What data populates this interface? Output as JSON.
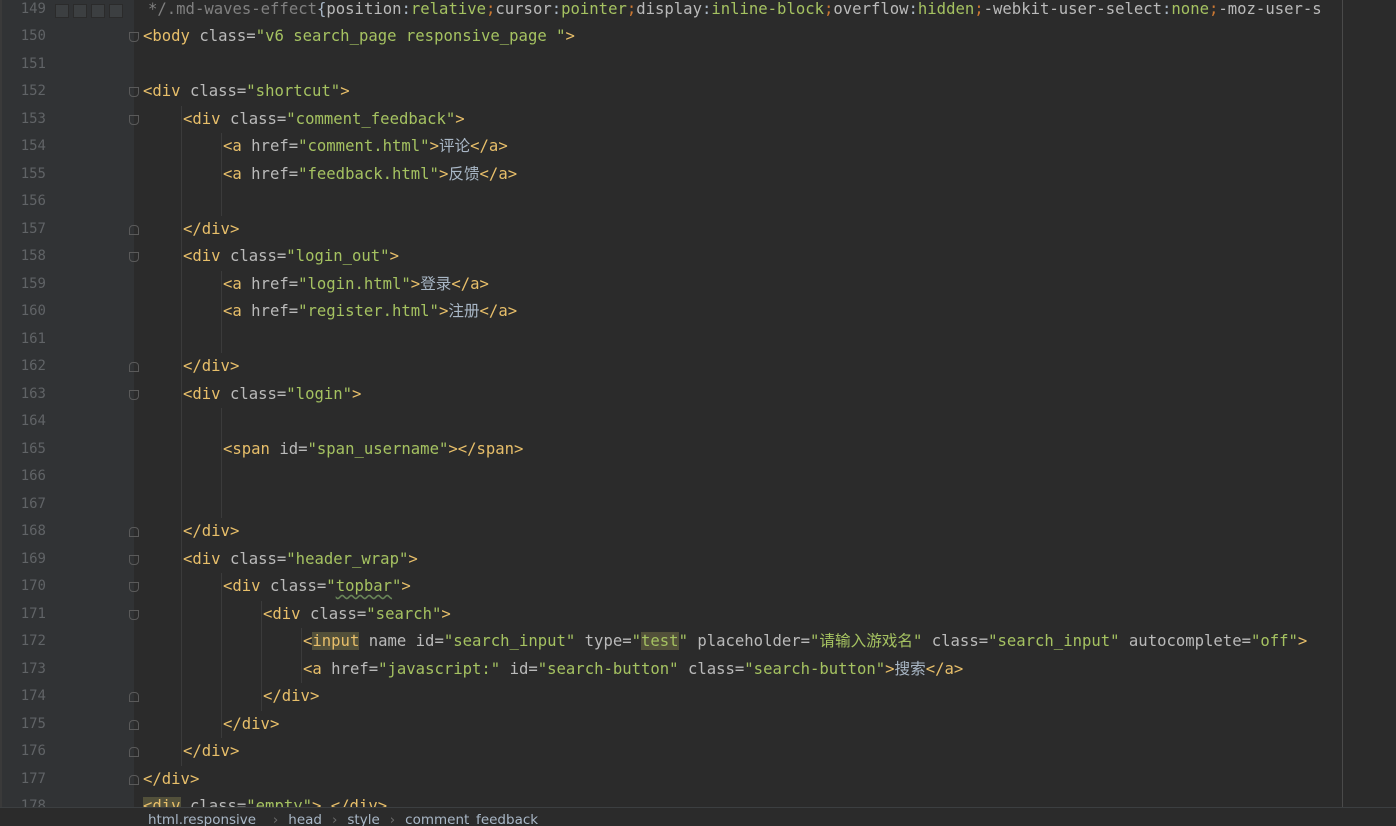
{
  "editor": {
    "lines": [
      {
        "n": "149",
        "fold": "none",
        "indent": 0,
        "tokens": [
          [
            "comment",
            " */.md-waves-effect"
          ],
          [
            "text",
            "{"
          ],
          [
            "cssprop",
            "position"
          ],
          [
            "text",
            ":"
          ],
          [
            "cssval",
            "relative"
          ],
          [
            "punct",
            ";"
          ],
          [
            "cssprop",
            "cursor"
          ],
          [
            "text",
            ":"
          ],
          [
            "cssval",
            "pointer"
          ],
          [
            "punct",
            ";"
          ],
          [
            "cssprop",
            "display"
          ],
          [
            "text",
            ":"
          ],
          [
            "cssval",
            "inline-block"
          ],
          [
            "punct",
            ";"
          ],
          [
            "cssprop",
            "overflow"
          ],
          [
            "text",
            ":"
          ],
          [
            "cssval",
            "hidden"
          ],
          [
            "punct",
            ";"
          ],
          [
            "cssprop",
            "-webkit-user-select"
          ],
          [
            "text",
            ":"
          ],
          [
            "cssval",
            "none"
          ],
          [
            "punct",
            ";"
          ],
          [
            "cssprop",
            "-moz-user-s"
          ]
        ]
      },
      {
        "n": "150",
        "fold": "open",
        "indent": 0,
        "tokens": [
          [
            "tag",
            "<body "
          ],
          [
            "attr",
            "class="
          ],
          [
            "str",
            "\"v6 search_page responsive_page \""
          ],
          [
            "tag",
            ">"
          ]
        ]
      },
      {
        "n": "151",
        "fold": "none",
        "indent": 0,
        "tokens": []
      },
      {
        "n": "152",
        "fold": "open",
        "indent": 0,
        "tokens": [
          [
            "tag",
            "<div "
          ],
          [
            "attr",
            "class="
          ],
          [
            "str",
            "\"shortcut\""
          ],
          [
            "tag",
            ">"
          ]
        ]
      },
      {
        "n": "153",
        "fold": "open",
        "indent": 1,
        "tokens": [
          [
            "tag",
            "<div "
          ],
          [
            "attr",
            "class="
          ],
          [
            "str",
            "\"comment_feedback\""
          ],
          [
            "tag",
            ">"
          ]
        ]
      },
      {
        "n": "154",
        "fold": "none",
        "indent": 2,
        "tokens": [
          [
            "tag",
            "<a "
          ],
          [
            "attr",
            "href="
          ],
          [
            "str",
            "\"comment.html\""
          ],
          [
            "tag",
            ">"
          ],
          [
            "text",
            "评论"
          ],
          [
            "tag",
            "</a>"
          ]
        ]
      },
      {
        "n": "155",
        "fold": "none",
        "indent": 2,
        "tokens": [
          [
            "tag",
            "<a "
          ],
          [
            "attr",
            "href="
          ],
          [
            "str",
            "\"feedback.html\""
          ],
          [
            "tag",
            ">"
          ],
          [
            "text",
            "反馈"
          ],
          [
            "tag",
            "</a>"
          ]
        ]
      },
      {
        "n": "156",
        "fold": "none",
        "indent": 2,
        "tokens": []
      },
      {
        "n": "157",
        "fold": "close",
        "indent": 1,
        "tokens": [
          [
            "tag",
            "</div>"
          ]
        ]
      },
      {
        "n": "158",
        "fold": "open",
        "indent": 1,
        "tokens": [
          [
            "tag",
            "<div "
          ],
          [
            "attr",
            "class="
          ],
          [
            "str",
            "\"login_out\""
          ],
          [
            "tag",
            ">"
          ]
        ]
      },
      {
        "n": "159",
        "fold": "none",
        "indent": 2,
        "tokens": [
          [
            "tag",
            "<a "
          ],
          [
            "attr",
            "href="
          ],
          [
            "str",
            "\"login.html\""
          ],
          [
            "tag",
            ">"
          ],
          [
            "text",
            "登录"
          ],
          [
            "tag",
            "</a>"
          ]
        ]
      },
      {
        "n": "160",
        "fold": "none",
        "indent": 2,
        "tokens": [
          [
            "tag",
            "<a "
          ],
          [
            "attr",
            "href="
          ],
          [
            "str",
            "\"register.html\""
          ],
          [
            "tag",
            ">"
          ],
          [
            "text",
            "注册"
          ],
          [
            "tag",
            "</a>"
          ]
        ]
      },
      {
        "n": "161",
        "fold": "none",
        "indent": 2,
        "tokens": []
      },
      {
        "n": "162",
        "fold": "close",
        "indent": 1,
        "tokens": [
          [
            "tag",
            "</div>"
          ]
        ]
      },
      {
        "n": "163",
        "fold": "open",
        "indent": 1,
        "tokens": [
          [
            "tag",
            "<div "
          ],
          [
            "attr",
            "class="
          ],
          [
            "str",
            "\"login\""
          ],
          [
            "tag",
            ">"
          ]
        ]
      },
      {
        "n": "164",
        "fold": "none",
        "indent": 2,
        "tokens": []
      },
      {
        "n": "165",
        "fold": "none",
        "indent": 2,
        "tokens": [
          [
            "tag",
            "<span "
          ],
          [
            "attr",
            "id="
          ],
          [
            "str",
            "\"span_username\""
          ],
          [
            "tag",
            "></span>"
          ]
        ]
      },
      {
        "n": "166",
        "fold": "none",
        "indent": 2,
        "tokens": []
      },
      {
        "n": "167",
        "fold": "none",
        "indent": 2,
        "tokens": []
      },
      {
        "n": "168",
        "fold": "close",
        "indent": 1,
        "tokens": [
          [
            "tag",
            "</div>"
          ]
        ]
      },
      {
        "n": "169",
        "fold": "open",
        "indent": 1,
        "tokens": [
          [
            "tag",
            "<div "
          ],
          [
            "attr",
            "class="
          ],
          [
            "str",
            "\"header_wrap\""
          ],
          [
            "tag",
            ">"
          ]
        ]
      },
      {
        "n": "170",
        "fold": "open",
        "indent": 2,
        "tokens": [
          [
            "tag",
            "<div "
          ],
          [
            "attr",
            "class="
          ],
          [
            "str",
            "\""
          ],
          [
            "strsq",
            "topbar"
          ],
          [
            "str",
            "\""
          ],
          [
            "tag",
            ">"
          ]
        ]
      },
      {
        "n": "171",
        "fold": "open",
        "indent": 3,
        "tokens": [
          [
            "tag",
            "<div "
          ],
          [
            "attr",
            "class="
          ],
          [
            "str",
            "\"search\""
          ],
          [
            "tag",
            ">"
          ]
        ]
      },
      {
        "n": "172",
        "fold": "none",
        "indent": 4,
        "tokens": [
          [
            "tag",
            "<"
          ],
          [
            "taghl",
            "input"
          ],
          [
            "attr",
            " name id="
          ],
          [
            "str",
            "\"search_input\""
          ],
          [
            "attr",
            " type="
          ],
          [
            "str",
            "\""
          ],
          [
            "strhl",
            "test"
          ],
          [
            "str",
            "\""
          ],
          [
            "attr",
            " placeholder="
          ],
          [
            "str",
            "\"请输入游戏名\""
          ],
          [
            "attr",
            " class="
          ],
          [
            "str",
            "\"search_input\""
          ],
          [
            "attr",
            " autocomplete="
          ],
          [
            "str",
            "\"off\""
          ],
          [
            "tag",
            ">"
          ]
        ]
      },
      {
        "n": "173",
        "fold": "none",
        "indent": 4,
        "tokens": [
          [
            "tag",
            "<a "
          ],
          [
            "attr",
            "href="
          ],
          [
            "str",
            "\"javascript:\""
          ],
          [
            "attr",
            " id="
          ],
          [
            "str",
            "\"search-button\""
          ],
          [
            "attr",
            " class="
          ],
          [
            "str",
            "\"search-button\""
          ],
          [
            "tag",
            ">"
          ],
          [
            "text",
            "搜索"
          ],
          [
            "tag",
            "</a>"
          ]
        ]
      },
      {
        "n": "174",
        "fold": "close",
        "indent": 3,
        "tokens": [
          [
            "tag",
            "</div>"
          ]
        ]
      },
      {
        "n": "175",
        "fold": "close",
        "indent": 2,
        "tokens": [
          [
            "tag",
            "</div>"
          ]
        ]
      },
      {
        "n": "176",
        "fold": "close",
        "indent": 1,
        "tokens": [
          [
            "tag",
            "</div>"
          ]
        ]
      },
      {
        "n": "177",
        "fold": "close",
        "indent": 0,
        "tokens": [
          [
            "tag",
            "</div>"
          ]
        ]
      },
      {
        "n": "178",
        "fold": "none",
        "indent": 0,
        "tokens": [
          [
            "taghl",
            "<div"
          ],
          [
            "attr",
            " class="
          ],
          [
            "str",
            "\"empty\""
          ],
          [
            "tag",
            "> </div>"
          ]
        ]
      }
    ]
  },
  "breadcrumb": {
    "items": [
      "html.responsive_",
      "head",
      "style",
      "comment_feedback"
    ]
  },
  "colors": {
    "background": "#2b2b2b",
    "gutter": "#313335",
    "tag": "#e8bf6a",
    "string": "#a5c261",
    "attribute": "#bababa",
    "text": "#a9b7c6"
  }
}
